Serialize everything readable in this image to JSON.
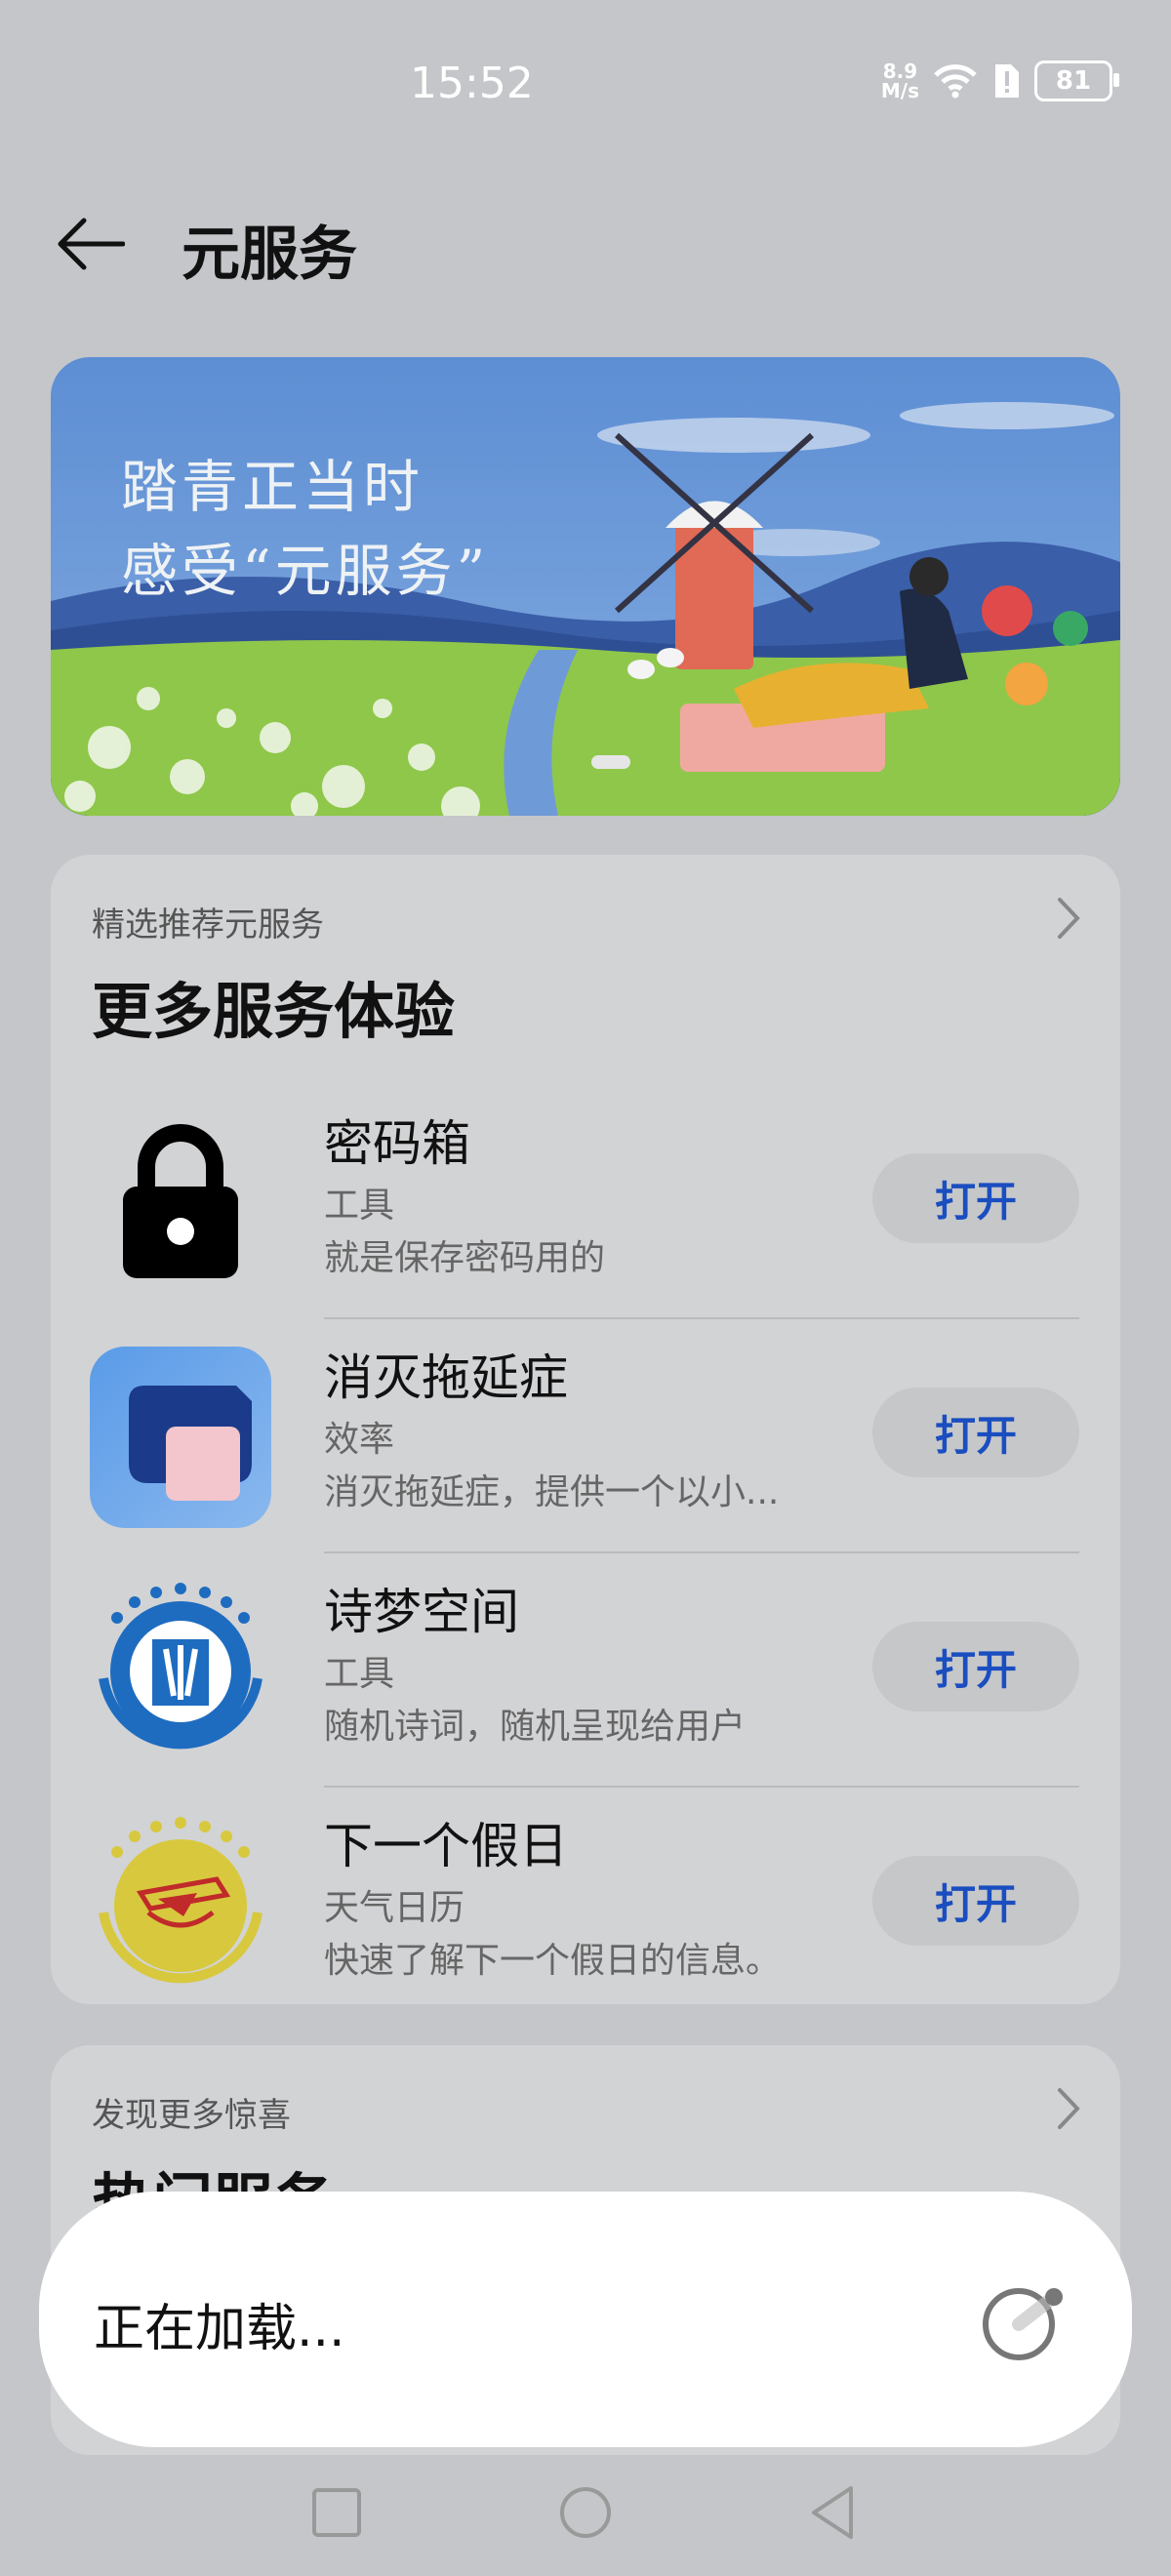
{
  "status_bar": {
    "time": "15:52",
    "speed_top": "8.9",
    "speed_bottom": "M/s",
    "battery": "81"
  },
  "header": {
    "title": "元服务"
  },
  "banner": {
    "line1": "踏青正当时",
    "line2": "感受“元服务”"
  },
  "featured": {
    "subtitle": "精选推荐元服务",
    "title": "更多服务体验",
    "items": [
      {
        "name": "密码箱",
        "category": "工具",
        "description": "就是保存密码用的",
        "button": "打开",
        "icon": "lock-icon"
      },
      {
        "name": "消灭拖延症",
        "category": "效率",
        "description": "消灭拖延症，提供一个以小...",
        "button": "打开",
        "icon": "procrastination-app-icon"
      },
      {
        "name": "诗梦空间",
        "category": "工具",
        "description": "随机诗词，随机呈现给用户",
        "button": "打开",
        "icon": "poetry-app-icon"
      },
      {
        "name": "下一个假日",
        "category": "天气日历",
        "description": "快速了解下一个假日的信息。",
        "button": "打开",
        "icon": "holiday-app-icon"
      }
    ]
  },
  "discover": {
    "subtitle": "发现更多惊喜",
    "title": "热门服务"
  },
  "loading": {
    "text": "正在加载..."
  },
  "colors": {
    "accent": "#1a4ec0",
    "background": "#c4c6c9",
    "card": "#d2d3d5"
  }
}
